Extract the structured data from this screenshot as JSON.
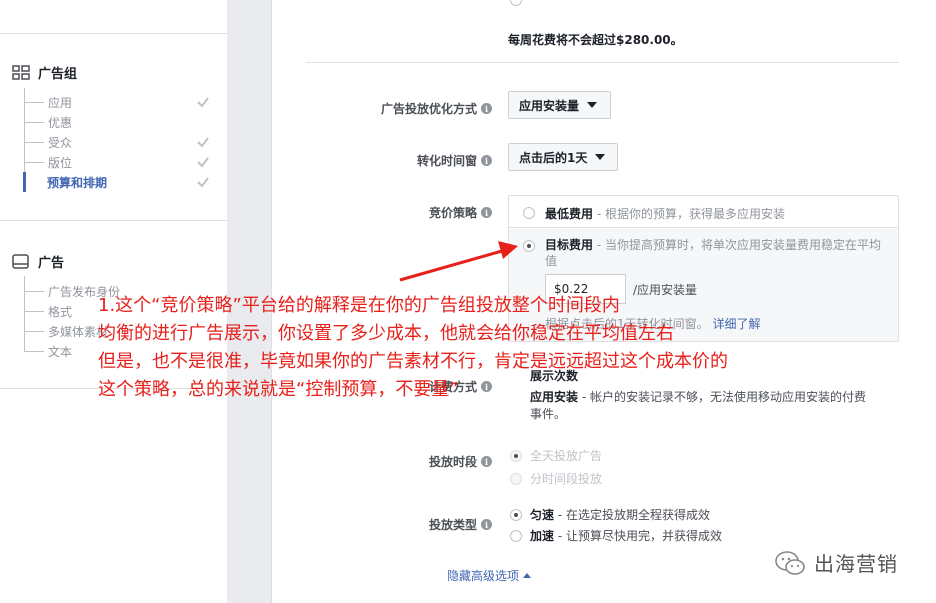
{
  "sidebar": {
    "adset": {
      "title": "广告组",
      "items": [
        {
          "label": "应用",
          "checked": true
        },
        {
          "label": "优惠",
          "checked": false
        },
        {
          "label": "受众",
          "checked": true
        },
        {
          "label": "版位",
          "checked": true
        },
        {
          "label": "预算和排期",
          "checked": true,
          "active": true
        }
      ]
    },
    "ad": {
      "title": "广告",
      "items": [
        {
          "label": "广告发布身份"
        },
        {
          "label": "格式"
        },
        {
          "label": "多媒体素材"
        },
        {
          "label": "文本"
        }
      ]
    }
  },
  "panel": {
    "weekly_cap": "每周花费将不会超过$280.00。",
    "optimization": {
      "label": "广告投放优化方式",
      "value": "应用安装量"
    },
    "conversion_window": {
      "label": "转化时间窗",
      "value": "点击后的1天"
    },
    "bid_strategy": {
      "label": "竞价策略",
      "lowest_cost": {
        "title": "最低费用",
        "desc": " - 根据你的预算，获得最多应用安装"
      },
      "target_cost": {
        "title": "目标费用",
        "desc": " - 当你提高预算时，将单次应用安装量费用稳定在平均",
        "desc2": "值",
        "amount": "$0.22",
        "unit": "/应用安装量",
        "note": "根据点击后的1天转化时间窗。",
        "learn_more": "详细了解"
      }
    },
    "billing": {
      "label": "计费方式",
      "impressions": "展示次数",
      "app_install_title": "应用安装",
      "app_install_desc": " - 帐户的安装记录不够，无法使用移动应用安装的付费",
      "app_install_desc2": "事件。"
    },
    "schedule": {
      "label": "投放时段",
      "all_day": "全天投放广告",
      "by_time": "分时间段投放"
    },
    "delivery": {
      "label": "投放类型",
      "standard_title": "匀速",
      "standard_desc": " - 在选定投放期全程获得成效",
      "accelerated_title": "加速",
      "accelerated_desc": " - 让预算尽快用完，并获得成效"
    },
    "hide_advanced": "隐藏高级选项"
  },
  "annotation": {
    "line1": "1.这个“竞价策略”平台给的解释是在你的广告组投放整个时间段内",
    "line2": "均衡的进行广告展示，你设置了多少成本，他就会给你稳定在平均值左右",
    "line3": "但是，也不是很准，毕竟如果你的广告素材不行，肯定是远远超过这个成本价的",
    "line4": "这个策略，总的来说就是“控制预算，不要量”"
  },
  "watermark": "出海营销",
  "colors": {
    "annotation": "#e8201b",
    "link": "#4267b2",
    "check": "#bec3c9"
  }
}
